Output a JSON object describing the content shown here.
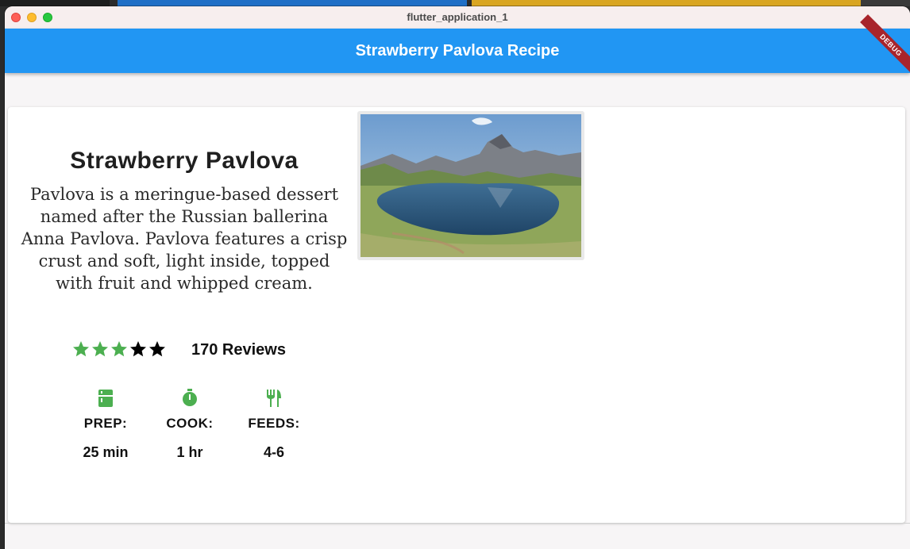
{
  "window": {
    "title": "flutter_application_1"
  },
  "appbar": {
    "title": "Strawberry Pavlova Recipe",
    "debug_banner": "DEBUG"
  },
  "recipe": {
    "title": "Strawberry Pavlova",
    "description": "Pavlova is a meringue-based dessert named after the Russian ballerina Anna Pavlova. Pavlova features a crisp crust and soft, light inside, topped with fruit and whipped cream.",
    "rating": {
      "filled": 3,
      "total": 5,
      "reviews_label": "170 Reviews"
    },
    "info": [
      {
        "icon": "kitchen-icon",
        "label": "PREP:",
        "value": "25 min"
      },
      {
        "icon": "timer-icon",
        "label": "COOK:",
        "value": "1 hr"
      },
      {
        "icon": "restaurant-icon",
        "label": "FEEDS:",
        "value": "4-6"
      }
    ]
  },
  "colors": {
    "appbar": "#2196f3",
    "accent_green": "#4caf50",
    "star_empty": "#000000"
  }
}
